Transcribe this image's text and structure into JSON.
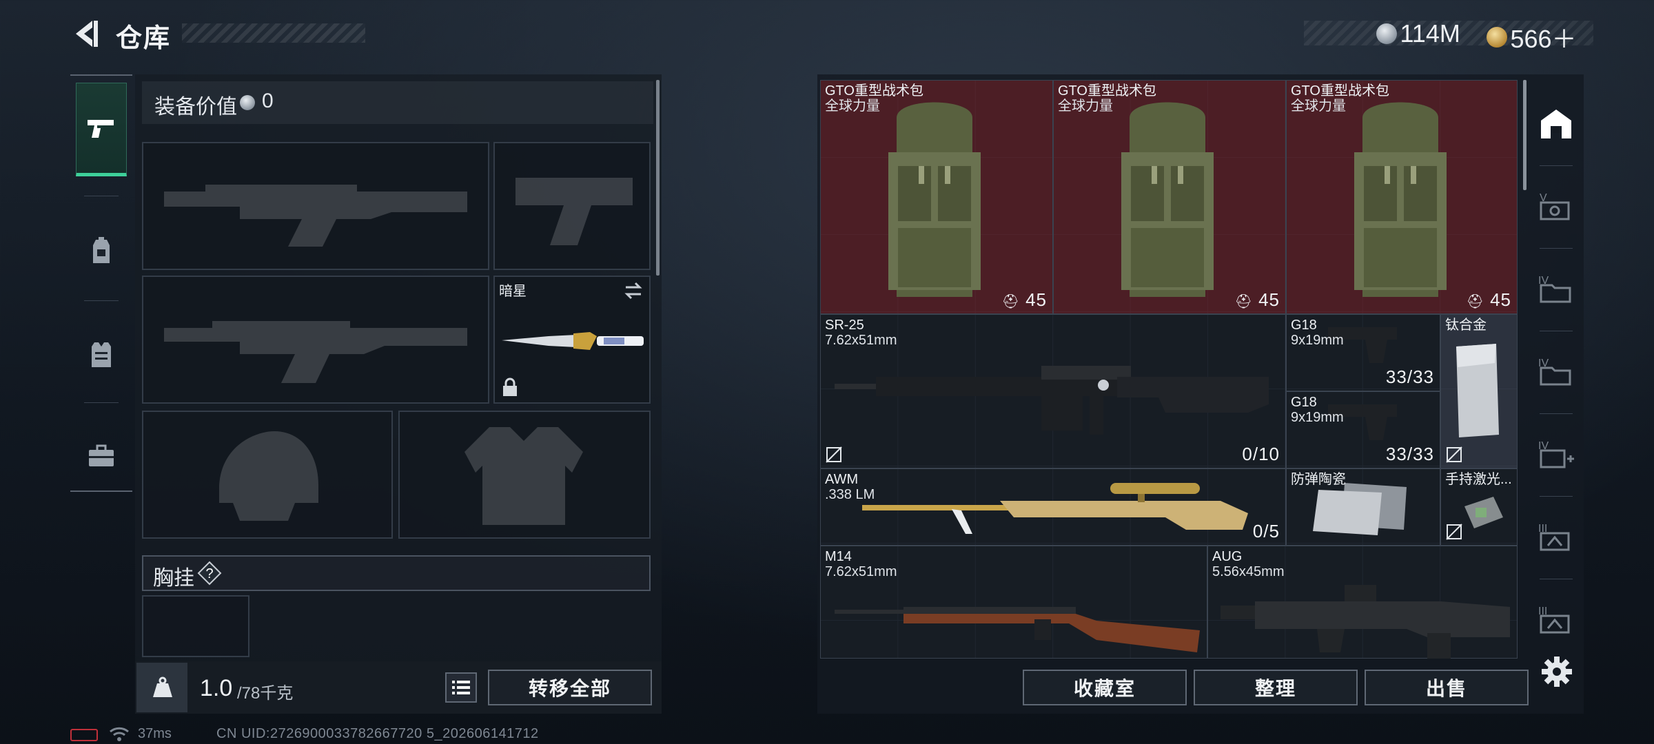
{
  "header": {
    "title": "仓库"
  },
  "currency": [
    {
      "icon": "silver-coin-icon",
      "amount": "114M"
    },
    {
      "icon": "gold-coin-icon",
      "amount": "566＋"
    }
  ],
  "left_nav": {
    "tabs": [
      {
        "icon": "pistol-icon",
        "active": true
      },
      {
        "icon": "backpack-icon",
        "active": false
      },
      {
        "icon": "vest-icon",
        "active": false
      },
      {
        "icon": "toolbox-icon",
        "active": false
      }
    ]
  },
  "loadout": {
    "value_label": "装备价值",
    "value": "0",
    "knife_name": "暗星",
    "vest_label": "胸挂",
    "vest_help": "?",
    "weight_current": "1.0",
    "weight_max": "/78千克",
    "transfer_label": "转移全部"
  },
  "warehouse": {
    "items": [
      {
        "name": "GTO重型战术包",
        "sub": "全球力量",
        "count": "45"
      },
      {
        "name": "GTO重型战术包",
        "sub": "全球力量",
        "count": "45"
      },
      {
        "name": "GTO重型战术包",
        "sub": "全球力量",
        "count": "45"
      },
      {
        "name": "SR-25",
        "sub": "7.62x51mm",
        "count": "0/10"
      },
      {
        "name": "G18",
        "sub": "9x19mm",
        "count": "33/33"
      },
      {
        "name": "G18",
        "sub": "9x19mm",
        "count": "33/33"
      },
      {
        "name": "钛合金",
        "sub": "",
        "count": ""
      },
      {
        "name": "AWM",
        "sub": ".338 LM",
        "count": "0/5"
      },
      {
        "name": "防弹陶瓷",
        "sub": "",
        "count": ""
      },
      {
        "name": "手持激光...",
        "sub": "",
        "count": ""
      },
      {
        "name": "M14",
        "sub": "7.62x51mm",
        "count": ""
      },
      {
        "name": "AUG",
        "sub": "5.56x45mm",
        "count": ""
      }
    ],
    "side_tabs": [
      "home-icon",
      "scope-icon",
      "folder-icon",
      "folder-icon",
      "medkit-icon",
      "frame-icon",
      "frame-icon"
    ],
    "buttons": {
      "collection": "收藏室",
      "organize": "整理",
      "sell": "出售"
    }
  },
  "status": {
    "ping": "37ms",
    "uid": "CN UID:2726900033782667720 5_202606141712"
  },
  "colors": {
    "accent": "#3ed09a",
    "rare_red": "#601e26"
  }
}
